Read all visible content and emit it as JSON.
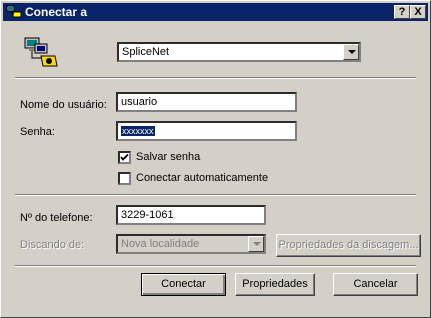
{
  "window": {
    "title": "Conectar a",
    "help_button": "?",
    "close_button": "X"
  },
  "connection": {
    "name": "SpliceNet"
  },
  "form": {
    "username_label": "Nome do usuário:",
    "username_value": "usuario",
    "password_label": "Senha:",
    "password_value": "xxxxxxx",
    "save_password_label": "Salvar senha",
    "save_password_checked": true,
    "auto_connect_label": "Conectar automaticamente",
    "auto_connect_checked": false,
    "phone_label": "Nº do telefone:",
    "phone_value": "3229-1061",
    "dialing_from_label": "Discando de:",
    "dialing_from_value": "Nova localidade",
    "dialing_properties_label": "Propriedades da discagem..."
  },
  "buttons": {
    "connect": "Conectar",
    "properties": "Propriedades",
    "cancel": "Cancelar"
  }
}
